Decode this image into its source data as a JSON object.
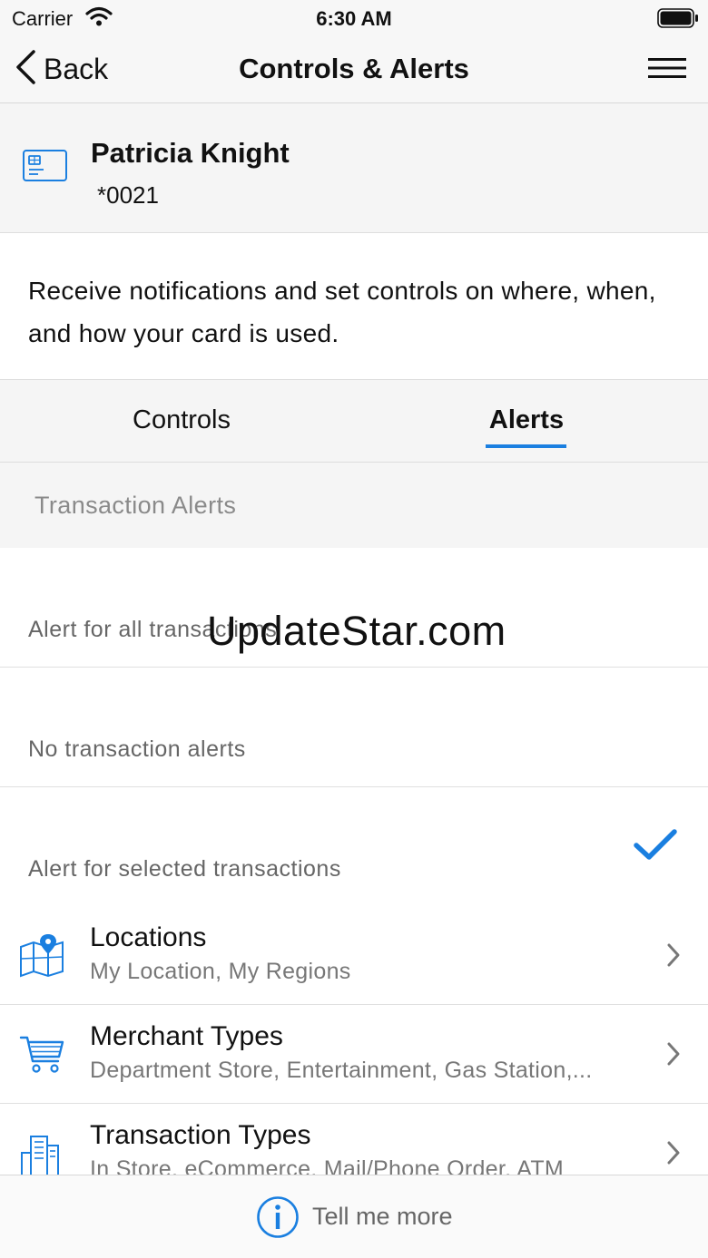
{
  "status_bar": {
    "carrier": "Carrier",
    "time": "6:30 AM",
    "icons": [
      "wifi-icon",
      "battery-icon"
    ]
  },
  "nav": {
    "back_label": "Back",
    "title": "Controls & Alerts",
    "icons": [
      "chevron-left-icon",
      "hamburger-menu-icon"
    ]
  },
  "card": {
    "name": "Patricia Knight",
    "number": "*0021",
    "icon": "credit-card-icon"
  },
  "description": "Receive notifications and set controls on where, when, and how your card is used.",
  "tabs": [
    {
      "label": "Controls",
      "active": false
    },
    {
      "label": "Alerts",
      "active": true
    }
  ],
  "section_title": "Transaction Alerts",
  "options": [
    {
      "label": "Alert for all transactions",
      "selected": false
    },
    {
      "label": "No transaction alerts",
      "selected": false
    },
    {
      "label": "Alert for selected transactions",
      "selected": true
    }
  ],
  "watermark": "UpdateStar.com",
  "nav_rows": [
    {
      "title": "Locations",
      "subtitle": "My Location, My Regions",
      "icon": "map-pin-icon"
    },
    {
      "title": "Merchant Types",
      "subtitle": "Department Store, Entertainment, Gas Station,...",
      "icon": "shopping-cart-icon"
    },
    {
      "title": "Transaction Types",
      "subtitle": "In Store, eCommerce, Mail/Phone Order, ATM",
      "icon": "buildings-icon"
    }
  ],
  "bottom": {
    "label": "Tell me more",
    "icon": "info-icon"
  },
  "colors": {
    "accent": "#1a7fe0",
    "bar_background": "#f7f7f7",
    "secondary_text": "#8a8a8a"
  }
}
